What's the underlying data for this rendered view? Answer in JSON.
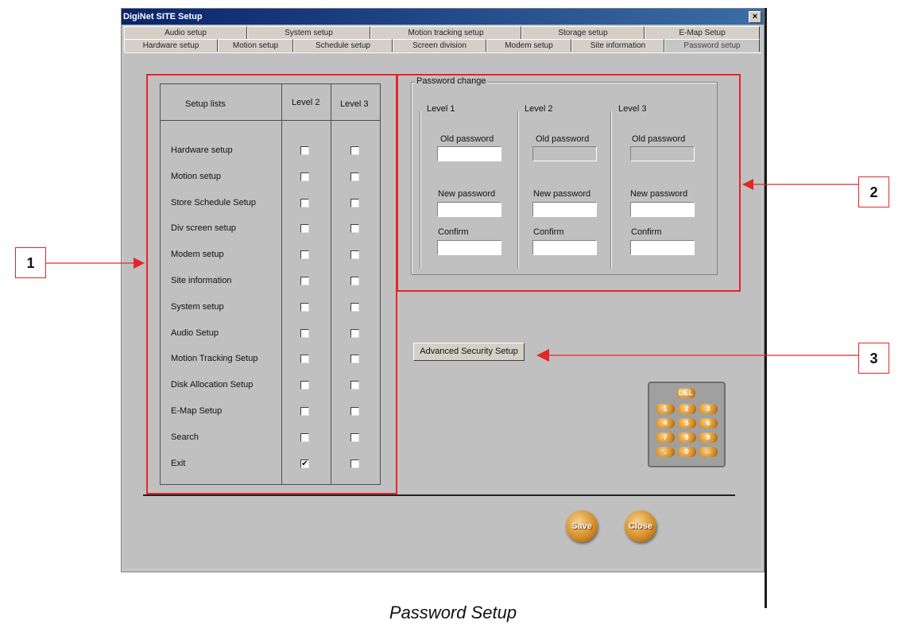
{
  "window": {
    "title": "DigiNet SITE Setup",
    "close_glyph": "×"
  },
  "tabs_row1": [
    "Audio setup",
    "System setup",
    "Motion tracking setup",
    "Storage setup",
    "E-Map Setup"
  ],
  "tabs_row2": [
    "Hardware setup",
    "Motion setup",
    "Schedule setup",
    "Screen division",
    "Modem setup",
    "Site information",
    "Password setup"
  ],
  "active_tab": "Password setup",
  "setup_table": {
    "header": {
      "setup_lists": "Setup lists",
      "level2": "Level 2",
      "level3": "Level 3"
    },
    "rows": [
      {
        "label": "Hardware setup",
        "level2": false,
        "level3": false
      },
      {
        "label": "Motion setup",
        "level2": false,
        "level3": false
      },
      {
        "label": "Store Schedule Setup",
        "level2": false,
        "level3": false
      },
      {
        "label": "Div screen setup",
        "level2": false,
        "level3": false
      },
      {
        "label": "Modem setup",
        "level2": false,
        "level3": false
      },
      {
        "label": "Site information",
        "level2": false,
        "level3": false
      },
      {
        "label": "System setup",
        "level2": false,
        "level3": false
      },
      {
        "label": "Audio Setup",
        "level2": false,
        "level3": false
      },
      {
        "label": "Motion Tracking Setup",
        "level2": false,
        "level3": false
      },
      {
        "label": "Disk Allocation Setup",
        "level2": false,
        "level3": false
      },
      {
        "label": "E-Map Setup",
        "level2": false,
        "level3": false
      },
      {
        "label": "Search",
        "level2": false,
        "level3": false
      },
      {
        "label": "Exit",
        "level2": true,
        "level3": false
      }
    ]
  },
  "password_change": {
    "title": "Password change",
    "levels": [
      {
        "title": "Level 1",
        "old": "Old password",
        "new": "New password",
        "confirm": "Confirm",
        "old_enabled": true
      },
      {
        "title": "Level 2",
        "old": "Old password",
        "new": "New password",
        "confirm": "Confirm",
        "old_enabled": false
      },
      {
        "title": "Level 3",
        "old": "Old password",
        "new": "New password",
        "confirm": "Confirm",
        "old_enabled": false
      }
    ]
  },
  "advanced_button": "Advanced Security Setup",
  "keypad": {
    "keys": [
      "DEL",
      "1",
      "2",
      "3",
      "4",
      "5",
      "6",
      "7",
      "8",
      "9",
      ".",
      "0",
      "←"
    ]
  },
  "save_button": "Save",
  "close_button": "Close",
  "callouts": [
    "1",
    "2",
    "3"
  ],
  "caption": "Password Setup",
  "colors": {
    "annotation_red": "#e2262b",
    "title_blue": "#0a246a",
    "gold_button": "#d48a23"
  }
}
